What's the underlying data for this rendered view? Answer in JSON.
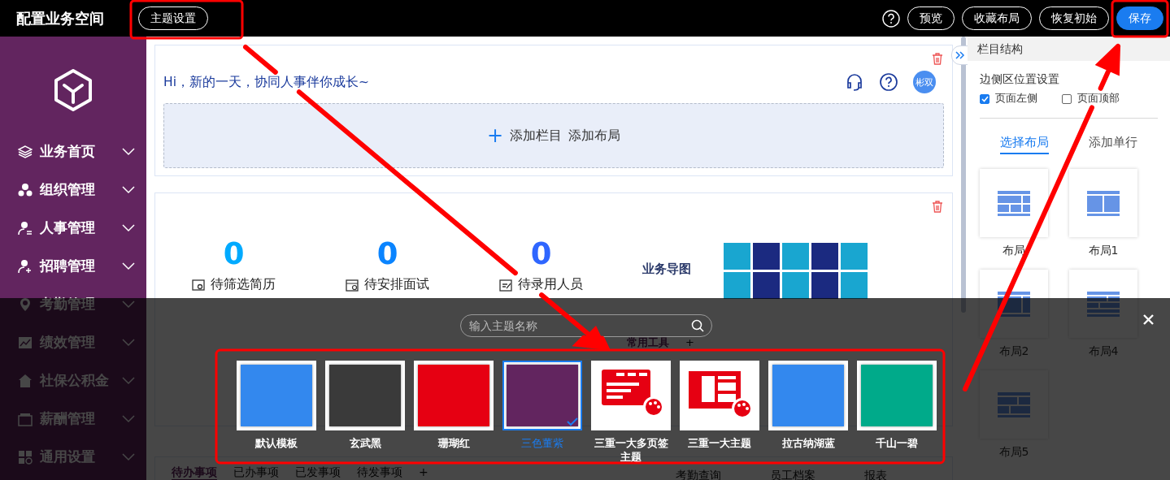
{
  "top_bar": {
    "title": "配置业务空间",
    "theme_button": "主题设置",
    "actions": [
      {
        "label": "预览",
        "kind": "outline"
      },
      {
        "label": "收藏布局",
        "kind": "outline"
      },
      {
        "label": "恢复初始",
        "kind": "outline"
      },
      {
        "label": "保存",
        "kind": "primary"
      }
    ]
  },
  "sidebar": {
    "items": [
      {
        "label": "业务首页"
      },
      {
        "label": "组织管理"
      },
      {
        "label": "人事管理"
      },
      {
        "label": "招聘管理"
      },
      {
        "label": "考勤管理"
      },
      {
        "label": "绩效管理"
      },
      {
        "label": "社保公积金"
      },
      {
        "label": "薪酬管理"
      },
      {
        "label": "通用设置"
      }
    ]
  },
  "main": {
    "greeting": "Hi，新的一天，协同人事伴你成长~",
    "avatar": "彬双",
    "add_box": {
      "plus": "+",
      "add_column": "添加栏目",
      "add_layout": "添加布局"
    },
    "stats": [
      {
        "value": "0",
        "label": "待筛选简历",
        "color": "#00aaff"
      },
      {
        "value": "0",
        "label": "待安排面试",
        "color": "#0a84ff"
      },
      {
        "value": "0",
        "label": "待录用人员",
        "color": "#2f66ff"
      }
    ],
    "map_title": "业务导图",
    "tools_tab": "常用工具",
    "tools_add": "+",
    "bottom_tabs": [
      {
        "label": "待办事项",
        "selected": true
      },
      {
        "label": "已办事项",
        "selected": false
      },
      {
        "label": "已发事项",
        "selected": false
      },
      {
        "label": "待发事项",
        "selected": false
      }
    ],
    "bottom_add": "+",
    "shortcuts": [
      "考勤查询",
      "员工档案",
      "报表"
    ]
  },
  "panel": {
    "title": "栏目结构",
    "section": "边侧区位置设置",
    "options": [
      {
        "label": "页面左侧",
        "checked": true
      },
      {
        "label": "页面顶部",
        "checked": false
      }
    ],
    "tabs": [
      {
        "label": "选择布局",
        "selected": true
      },
      {
        "label": "添加单行",
        "selected": false
      }
    ],
    "layouts": [
      "布局",
      "布局1",
      "布局2",
      "布局4",
      "布局5"
    ]
  },
  "theme_overlay": {
    "search": {
      "placeholder": "输入主题名称"
    },
    "themes": [
      {
        "name": "默认模板",
        "kind": "swatch",
        "color": "#3388ee",
        "selected": false
      },
      {
        "name": "玄武黑",
        "kind": "swatch",
        "color": "#3a3a3a",
        "selected": false
      },
      {
        "name": "珊瑚红",
        "kind": "swatch",
        "color": "#e60012",
        "selected": false
      },
      {
        "name": "三色董紫",
        "kind": "swatch",
        "color": "#62255f",
        "selected": true
      },
      {
        "name": "三重一大多页签主题",
        "kind": "tabs-illustration",
        "color": "#e60012",
        "selected": false
      },
      {
        "name": "三重一大主题",
        "kind": "grid-illustration",
        "color": "#e60012",
        "selected": false
      },
      {
        "name": "拉古纳湖蓝",
        "kind": "swatch",
        "color": "#3388ee",
        "selected": false
      },
      {
        "name": "千山一碧",
        "kind": "swatch",
        "color": "#00aa8a",
        "selected": false
      }
    ]
  }
}
